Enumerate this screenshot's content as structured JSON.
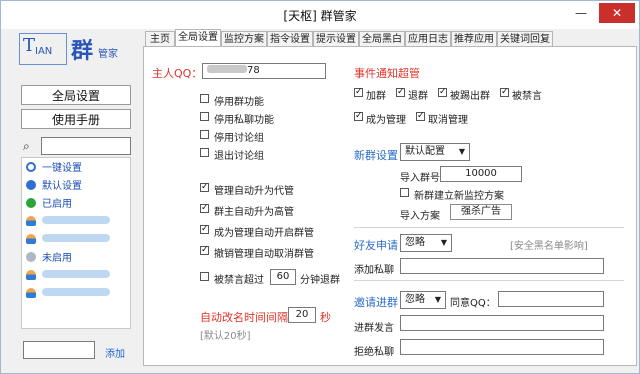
{
  "window": {
    "title": "[天枢] 群管家",
    "min": "—",
    "close": "✕"
  },
  "logo": {
    "t": "T",
    "ian": "IAN",
    "qun": "群",
    "guanjia": "管家"
  },
  "sidebar": {
    "global_btn": "全局设置",
    "manual_btn": "使用手册",
    "items": [
      {
        "label": "一键设置",
        "icon": "gear-icon"
      },
      {
        "label": "默认设置",
        "icon": "location-icon"
      },
      {
        "label": "已启用",
        "icon": "green-dot-icon"
      },
      {
        "label": "未启用",
        "icon": "gray-dot-icon"
      }
    ],
    "add_link": "添加"
  },
  "tabs": [
    "主页",
    "全局设置",
    "监控方案",
    "指令设置",
    "提示设置",
    "全局黑白",
    "应用日志",
    "推荐应用",
    "关键词回复"
  ],
  "main": {
    "owner_qq_label": "主人QQ：",
    "owner_qq_suffix": "78",
    "left_checks": [
      {
        "label": "停用群功能",
        "checked": false
      },
      {
        "label": "停用私聊功能",
        "checked": false
      },
      {
        "label": "停用讨论组",
        "checked": false
      },
      {
        "label": "退出讨论组",
        "checked": false
      },
      {
        "label": "管理自动升为代管",
        "checked": true
      },
      {
        "label": "群主自动升为高管",
        "checked": true
      },
      {
        "label": "成为管理自动开启群管",
        "checked": true
      },
      {
        "label": "撤销管理自动取消群管",
        "checked": true
      }
    ],
    "kick_over_label": "被禁言超过",
    "kick_over_value": "60",
    "kick_over_suffix": "分钟退群",
    "rename_label": "自动改名时间间隔",
    "rename_value": "20",
    "rename_unit": "秒",
    "rename_default": "[默认20秒]",
    "event_title": "事件通知超管",
    "event_checks": [
      {
        "label": "加群",
        "checked": true
      },
      {
        "label": "退群",
        "checked": true
      },
      {
        "label": "被踢出群",
        "checked": true
      },
      {
        "label": "被禁言",
        "checked": true
      },
      {
        "label": "成为管理",
        "checked": true
      },
      {
        "label": "取消管理",
        "checked": true
      }
    ],
    "newgroup_label": "新群设置",
    "newgroup_select": "默认配置",
    "import_group_label": "导入群号",
    "import_group_value": "10000",
    "new_monitor_label": "新群建立新监控方案",
    "import_plan_label": "导入方案",
    "import_plan_value": "强杀广告",
    "friend_label": "好友申请",
    "friend_select": "忽略",
    "friend_note": "[安全黑名单影响]",
    "add_private_label": "添加私聊",
    "invite_label": "邀请进群",
    "invite_select": "忽略",
    "agree_qq_label": "同意QQ：",
    "invite_speech_label": "进群发言",
    "reject_private_label": "拒绝私聊"
  }
}
